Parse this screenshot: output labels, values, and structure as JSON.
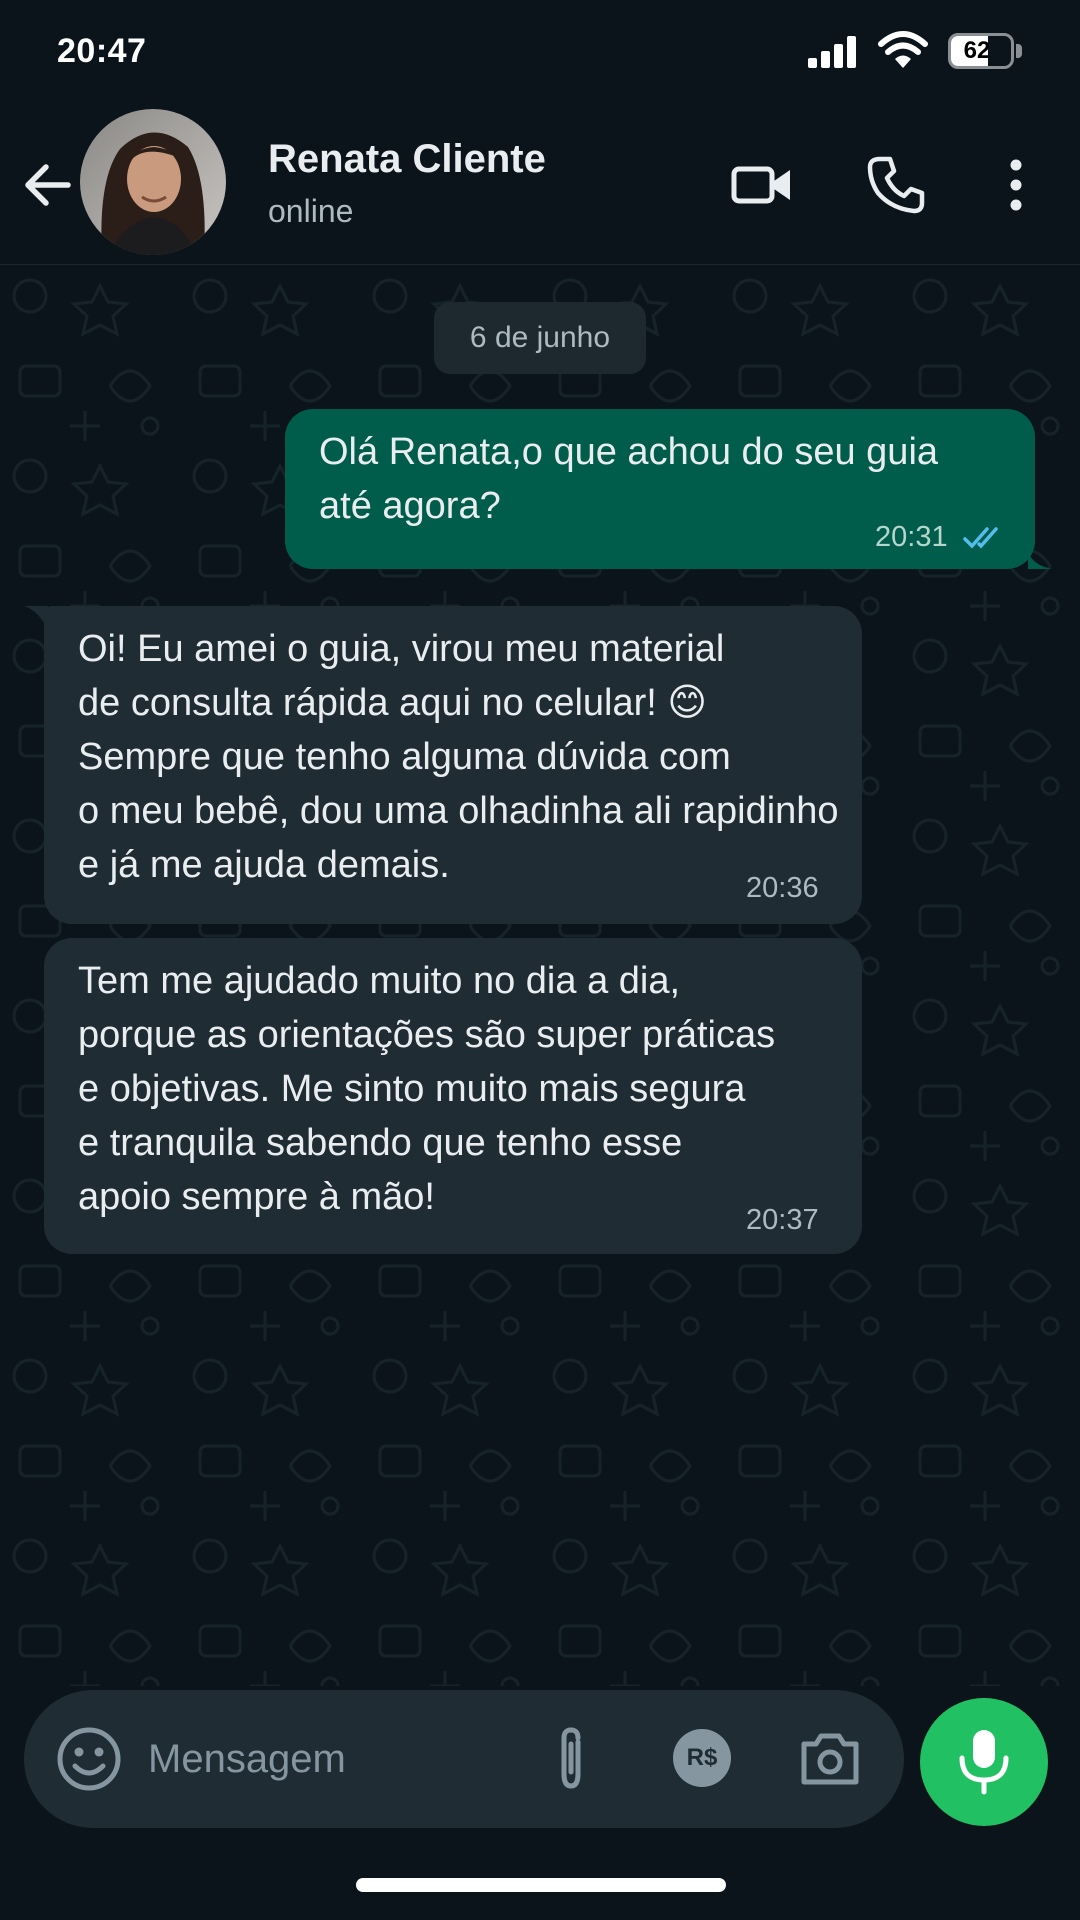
{
  "status_bar": {
    "time": "20:47",
    "battery_percent": "62",
    "battery_level": 0.62
  },
  "header": {
    "contact_name": "Renata Cliente",
    "contact_status": "online"
  },
  "chat": {
    "date_chip": "6 de junho",
    "messages": [
      {
        "direction": "outgoing",
        "lines": [
          "Olá Renata,o que achou do seu guia",
          "até agora?"
        ],
        "time": "20:31",
        "read": true
      },
      {
        "direction": "incoming",
        "lines": [
          "Oi! Eu amei o guia, virou meu material",
          "de consulta rápida aqui no celular! 😊",
          "Sempre que tenho alguma dúvida com",
          "o meu bebê, dou uma olhadinha ali rapidinho",
          "e já me ajuda demais."
        ],
        "time": "20:36"
      },
      {
        "direction": "incoming",
        "lines": [
          "Tem me ajudado muito no dia a dia,",
          "porque as orientações são super práticas",
          "e objetivas. Me sinto muito mais segura",
          "e tranquila sabendo que tenho esse",
          "apoio sempre à mão!"
        ],
        "time": "20:37"
      }
    ]
  },
  "composer": {
    "placeholder": "Mensagem",
    "payment_label": "R$"
  },
  "colors": {
    "background": "#0b141a",
    "outgoing_bubble": "#005c4b",
    "incoming_bubble": "#1f2c34",
    "accent_green": "#21c063",
    "read_ticks": "#53bdeb"
  },
  "icons": {
    "back": "arrow-left-icon",
    "video": "video-camera-icon",
    "call": "phone-icon",
    "menu": "more-vertical-icon",
    "emoji": "smiley-icon",
    "attach": "paperclip-icon",
    "payment": "currency-icon",
    "camera": "camera-icon",
    "mic": "microphone-icon",
    "signal": "cell-signal-icon",
    "wifi": "wifi-icon"
  }
}
